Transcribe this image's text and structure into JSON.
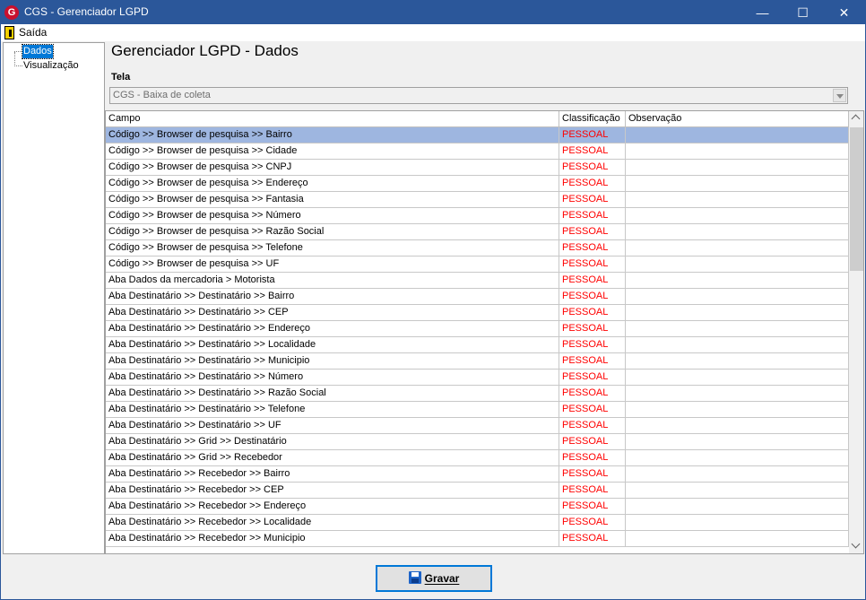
{
  "window": {
    "title": "CGS - Gerenciador LGPD",
    "controls": {
      "minimize": "—",
      "maximize": "☐",
      "close": "✕"
    }
  },
  "menu": {
    "exit_label": "Saída"
  },
  "tree": {
    "items": [
      {
        "label": "Dados",
        "selected": true
      },
      {
        "label": "Visualização",
        "selected": false
      }
    ]
  },
  "page": {
    "title": "Gerenciador LGPD - Dados"
  },
  "tela": {
    "label": "Tela",
    "value": "CGS - Baixa de coleta"
  },
  "grid": {
    "headers": {
      "campo": "Campo",
      "classificacao": "Classificação",
      "observacao": "Observação"
    },
    "rows": [
      {
        "campo": "Código >> Browser de pesquisa >> Bairro",
        "classificacao": "PESSOAL",
        "observacao": ""
      },
      {
        "campo": "Código >> Browser de pesquisa >> Cidade",
        "classificacao": "PESSOAL",
        "observacao": ""
      },
      {
        "campo": "Código >> Browser de pesquisa >> CNPJ",
        "classificacao": "PESSOAL",
        "observacao": ""
      },
      {
        "campo": "Código >> Browser de pesquisa >> Endereço",
        "classificacao": "PESSOAL",
        "observacao": ""
      },
      {
        "campo": "Código >> Browser de pesquisa >> Fantasia",
        "classificacao": "PESSOAL",
        "observacao": ""
      },
      {
        "campo": "Código >> Browser de pesquisa >> Número",
        "classificacao": "PESSOAL",
        "observacao": ""
      },
      {
        "campo": "Código >> Browser de pesquisa >> Razão Social",
        "classificacao": "PESSOAL",
        "observacao": ""
      },
      {
        "campo": "Código >> Browser de pesquisa >> Telefone",
        "classificacao": "PESSOAL",
        "observacao": ""
      },
      {
        "campo": "Código >> Browser de pesquisa >> UF",
        "classificacao": "PESSOAL",
        "observacao": ""
      },
      {
        "campo": "Aba Dados da mercadoria > Motorista",
        "classificacao": "PESSOAL",
        "observacao": ""
      },
      {
        "campo": "Aba Destinatário >> Destinatário >> Bairro",
        "classificacao": "PESSOAL",
        "observacao": ""
      },
      {
        "campo": "Aba Destinatário >> Destinatário >> CEP",
        "classificacao": "PESSOAL",
        "observacao": ""
      },
      {
        "campo": "Aba Destinatário >> Destinatário >> Endereço",
        "classificacao": "PESSOAL",
        "observacao": ""
      },
      {
        "campo": "Aba Destinatário >> Destinatário >> Localidade",
        "classificacao": "PESSOAL",
        "observacao": ""
      },
      {
        "campo": "Aba Destinatário >> Destinatário >> Municipio",
        "classificacao": "PESSOAL",
        "observacao": ""
      },
      {
        "campo": "Aba Destinatário >> Destinatário >> Número",
        "classificacao": "PESSOAL",
        "observacao": ""
      },
      {
        "campo": "Aba Destinatário >> Destinatário >> Razão Social",
        "classificacao": "PESSOAL",
        "observacao": ""
      },
      {
        "campo": "Aba Destinatário >> Destinatário >> Telefone",
        "classificacao": "PESSOAL",
        "observacao": ""
      },
      {
        "campo": "Aba Destinatário >> Destinatário >> UF",
        "classificacao": "PESSOAL",
        "observacao": ""
      },
      {
        "campo": "Aba Destinatário >> Grid >> Destinatário",
        "classificacao": "PESSOAL",
        "observacao": ""
      },
      {
        "campo": "Aba Destinatário >> Grid >> Recebedor",
        "classificacao": "PESSOAL",
        "observacao": ""
      },
      {
        "campo": "Aba Destinatário >> Recebedor >> Bairro",
        "classificacao": "PESSOAL",
        "observacao": ""
      },
      {
        "campo": "Aba Destinatário >> Recebedor >> CEP",
        "classificacao": "PESSOAL",
        "observacao": ""
      },
      {
        "campo": "Aba Destinatário >> Recebedor >> Endereço",
        "classificacao": "PESSOAL",
        "observacao": ""
      },
      {
        "campo": "Aba Destinatário >> Recebedor >> Localidade",
        "classificacao": "PESSOAL",
        "observacao": ""
      },
      {
        "campo": "Aba Destinatário >> Recebedor >> Municipio",
        "classificacao": "PESSOAL",
        "observacao": ""
      }
    ]
  },
  "footer": {
    "save_label": "Gravar"
  },
  "colors": {
    "titlebar": "#2b579a",
    "selected_row": "#9eb6e0",
    "classification_text": "#ff0000",
    "tree_selection": "#0078d7"
  }
}
